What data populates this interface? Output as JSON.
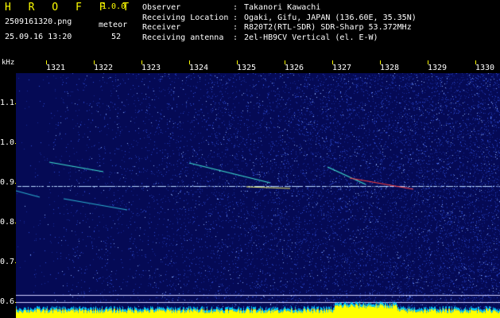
{
  "header": {
    "app_title": "H R O F F T",
    "app_version": "1.0.0",
    "file_name": "2509161320.png",
    "date_time": "25.09.16 13:20",
    "meteor_label": "meteor",
    "meteor_count": "52"
  },
  "info": [
    {
      "key": "Observer",
      "sep": ":",
      "value": "Takanori Kawachi"
    },
    {
      "key": "Receiving Location",
      "sep": ":",
      "value": "Ogaki, Gifu, JAPAN (136.60E, 35.35N)"
    },
    {
      "key": "Receiver",
      "sep": ":",
      "value": "R820T2(RTL-SDR) SDR-Sharp 53.372MHz"
    },
    {
      "key": "Receiving antenna",
      "sep": ":",
      "value": "2el-HB9CV Vertical (el. E-W)"
    }
  ],
  "chart_data": {
    "type": "heatmap",
    "y_unit_label": "kHz",
    "x_ticks": [
      "1321",
      "1322",
      "1323",
      "1324",
      "1325",
      "1326",
      "1327",
      "1328",
      "1329",
      "1330"
    ],
    "y_ticks": [
      "1.1",
      "1.0",
      "0.9",
      "0.8",
      "0.7",
      "0.6"
    ],
    "ylim": [
      0.58,
      1.17
    ],
    "colors": {
      "background": "#050a55",
      "noise": "#2f4fd6",
      "signal": "#3fe0d0",
      "strong": "#ff4040",
      "floor": "#ffff00",
      "axis": "#ffff00"
    }
  }
}
